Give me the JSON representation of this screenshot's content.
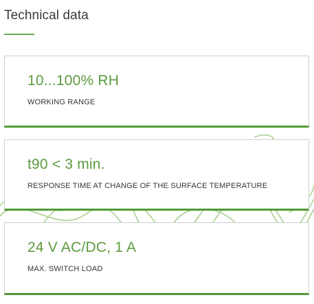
{
  "section": {
    "title": "Technical data"
  },
  "specs": [
    {
      "value": "10...100% RH",
      "label": "WORKING RANGE"
    },
    {
      "value": "t90 < 3 min.",
      "label": "RESPONSE TIME AT CHANGE OF THE SURFACE TEMPERATURE"
    },
    {
      "value": "24 V AC/DC, 1 A",
      "label": "MAX. SWITCH LOAD"
    }
  ],
  "colors": {
    "accent": "#5b9a3f",
    "card_bottom_border": "#4f9a35",
    "card_border": "#cfcfcf",
    "decoration": "#9cc77f"
  }
}
